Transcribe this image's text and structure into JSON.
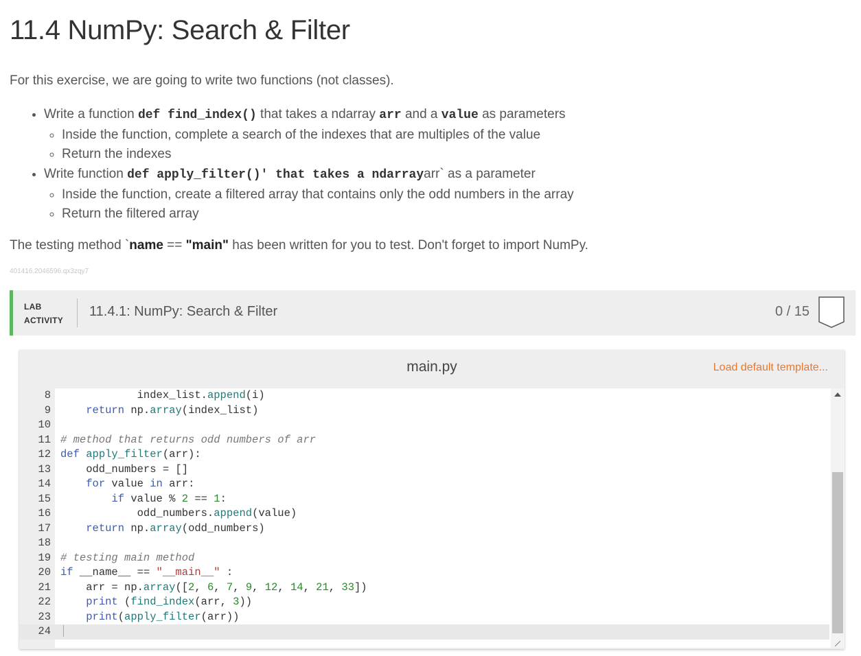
{
  "page": {
    "title": "11.4 NumPy: Search & Filter",
    "intro": "For this exercise, we are going to write two functions (not classes).",
    "bullets": [
      {
        "pre": "Write a function ",
        "code1": "def find_index()",
        "mid1": " that takes a ndarray ",
        "code2": "arr",
        "mid2": " and a ",
        "code3": "value",
        "post": " as parameters",
        "sub": [
          "Inside the function, complete a search of the indexes that are multiples of the value",
          "Return the indexes"
        ]
      },
      {
        "pre": "Write function ",
        "code1": "def apply_filter()' that takes a ndarray",
        "post": "arr` as a parameter",
        "sub": [
          "Inside the function, create a filtered array that contains only the odd numbers in the array",
          "Return the filtered array"
        ]
      }
    ],
    "testing": {
      "pre": "The testing method `",
      "b1": "name",
      "mid": " == ",
      "b2": "\"main\"",
      "post": " has been written for you to test. Don't forget to import NumPy."
    },
    "ref_id": "401416.2046596.qx3zqy7"
  },
  "lab": {
    "tag_line1": "LAB",
    "tag_line2": "ACTIVITY",
    "title": "11.4.1: NumPy: Search & Filter",
    "score": "0 / 15",
    "accent_color": "#5cb85c"
  },
  "editor": {
    "file_name": "main.py",
    "load_template_label": "Load default template...",
    "load_template_color": "#e8782a",
    "lines": [
      {
        "n": "8",
        "code": "            index_list.append(i)"
      },
      {
        "n": "9",
        "code": "    return np.array(index_list)"
      },
      {
        "n": "10",
        "code": ""
      },
      {
        "n": "11",
        "code": "# method that returns odd numbers of arr"
      },
      {
        "n": "12",
        "code": "def apply_filter(arr):"
      },
      {
        "n": "13",
        "code": "    odd_numbers = []"
      },
      {
        "n": "14",
        "code": "    for value in arr:"
      },
      {
        "n": "15",
        "code": "        if value % 2 == 1:"
      },
      {
        "n": "16",
        "code": "            odd_numbers.append(value)"
      },
      {
        "n": "17",
        "code": "    return np.array(odd_numbers)"
      },
      {
        "n": "18",
        "code": ""
      },
      {
        "n": "19",
        "code": "# testing main method"
      },
      {
        "n": "20",
        "code": "if __name__ == \"__main__\" :"
      },
      {
        "n": "21",
        "code": "    arr = np.array([2, 6, 7, 9, 12, 14, 21, 33])"
      },
      {
        "n": "22",
        "code": "    print (find_index(arr, 3))"
      },
      {
        "n": "23",
        "code": "    print(apply_filter(arr))"
      },
      {
        "n": "24",
        "code": ""
      }
    ]
  }
}
